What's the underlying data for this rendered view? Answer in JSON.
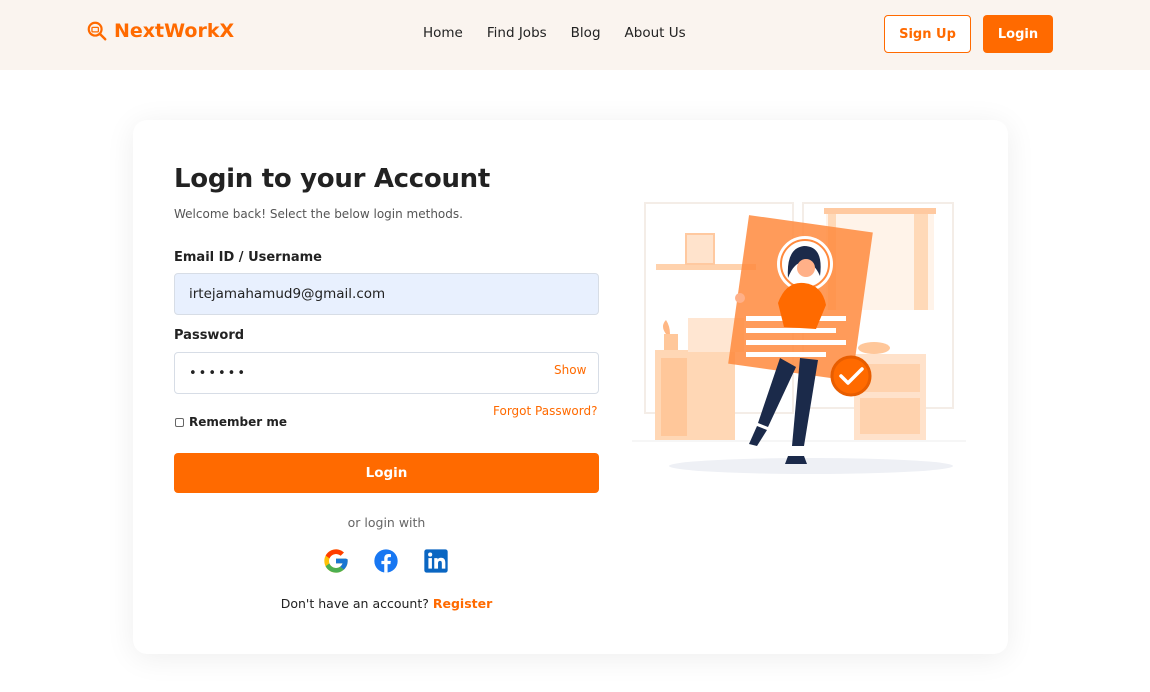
{
  "nav": {
    "brand": "NextWorkX",
    "links": [
      "Home",
      "Find Jobs",
      "Blog",
      "About Us"
    ],
    "signup_label": "Sign Up",
    "login_label": "Login"
  },
  "form": {
    "title": "Login to your Account",
    "subtitle": "Welcome back! Select the below login methods.",
    "email_label": "Email ID / Username",
    "email_value": "irtejamahamud9@gmail.com",
    "password_label": "Password",
    "password_value": "••••••",
    "show_label": "Show",
    "remember_label": "Remember me",
    "forgot_label": "Forgot Password?",
    "submit_label": "Login",
    "or_text": "or login with",
    "no_account_text": "Don't have an account?",
    "register_label": "Register"
  },
  "social_icons": [
    "google-icon",
    "facebook-icon",
    "linkedin-icon"
  ],
  "colors": {
    "accent": "#ff6a00",
    "navbar_bg": "#faf4ef",
    "input_filled_bg": "#e8f0fe",
    "facebook": "#1877f2",
    "linkedin": "#0a66c2"
  }
}
